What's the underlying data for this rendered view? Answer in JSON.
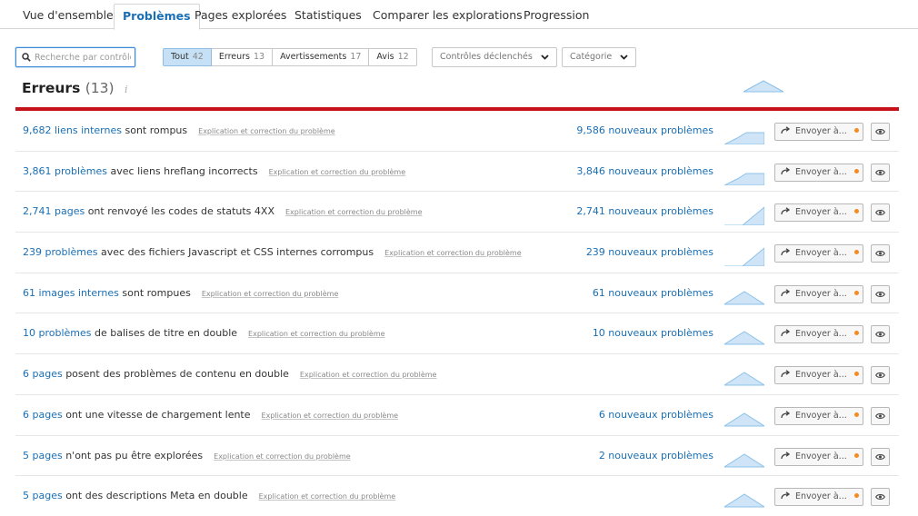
{
  "tabs": [
    {
      "label": "Vue d'ensemble",
      "active": false
    },
    {
      "label": "Problèmes",
      "active": true
    },
    {
      "label": "Pages explorées",
      "active": false
    },
    {
      "label": "Statistiques",
      "active": false
    },
    {
      "label": "Comparer les explorations",
      "active": false
    },
    {
      "label": "Progression",
      "active": false
    }
  ],
  "search": {
    "placeholder": "Recherche par contrôle",
    "value": ""
  },
  "filters": [
    {
      "label": "Tout",
      "count": "42",
      "active": true
    },
    {
      "label": "Erreurs",
      "count": "13",
      "active": false
    },
    {
      "label": "Avertissements",
      "count": "17",
      "active": false
    },
    {
      "label": "Avis",
      "count": "12",
      "active": false
    }
  ],
  "dropdowns": {
    "triggered": "Contrôles déclenchés",
    "category": "Catégorie"
  },
  "section": {
    "title": "Erreurs",
    "count": "(13)",
    "info_icon": "i"
  },
  "explain_label": "Explication et correction du problème",
  "send_label": "Envoyer à...",
  "colors": {
    "accent": "#1a6fb5",
    "danger": "#c5121b",
    "dot": "#f58a1f",
    "spark_fill": "#cfe5f7",
    "spark_stroke": "#8cc1ea"
  },
  "rows": [
    {
      "link": "9,682 liens internes",
      "rest": " sont rompus",
      "new": "9,586 nouveaux problèmes",
      "trend": "plateau"
    },
    {
      "link": "3,861 problèmes",
      "rest": " avec liens hreflang incorrects",
      "new": "3,846 nouveaux problèmes",
      "trend": "plateau"
    },
    {
      "link": "2,741 pages",
      "rest": " ont renvoyé les codes de statuts 4XX",
      "new": "2,741 nouveaux problèmes",
      "trend": "rising"
    },
    {
      "link": "239 problèmes",
      "rest": " avec des fichiers Javascript et CSS internes corrompus",
      "new": "239 nouveaux problèmes",
      "trend": "rising"
    },
    {
      "link": "61 images internes",
      "rest": " sont rompues",
      "new": "61 nouveaux problèmes",
      "trend": "peak"
    },
    {
      "link": "10 problèmes",
      "rest": " de balises de titre en double",
      "new": "10 nouveaux problèmes",
      "trend": "peak"
    },
    {
      "link": "6 pages",
      "rest": " posent des problèmes de contenu en double",
      "new": "",
      "trend": "peak"
    },
    {
      "link": "6 pages",
      "rest": " ont une vitesse de chargement lente",
      "new": "6 nouveaux problèmes",
      "trend": "peak"
    },
    {
      "link": "5 pages",
      "rest": " n'ont pas pu être explorées",
      "new": "2 nouveaux problèmes",
      "trend": "peak"
    },
    {
      "link": "5 pages",
      "rest": " ont des descriptions Meta en double",
      "new": "",
      "trend": "peak"
    }
  ]
}
